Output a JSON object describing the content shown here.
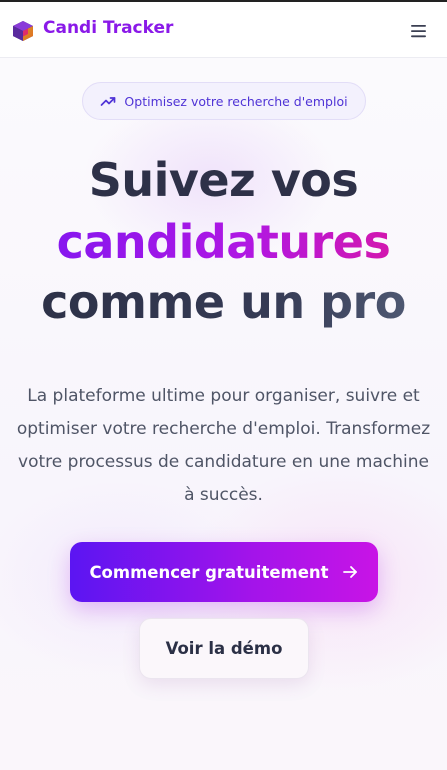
{
  "header": {
    "brand": "Candi Tracker",
    "logo_icon": "candi-logo-icon",
    "menu_icon": "hamburger-menu-icon"
  },
  "hero": {
    "badge": {
      "icon": "trending-up-icon",
      "text": "Optimisez votre recherche d'emploi"
    },
    "title_line1": "Suivez vos",
    "title_line2": "candidatures",
    "title_line3": "comme un pro",
    "description": "La plateforme ultime pour organiser, suivre et optimiser votre recherche d'emploi. Transformez votre processus de candidature en une machine à succès.",
    "primary_cta": {
      "label": "Commencer gratuitement",
      "icon": "arrow-right-icon"
    },
    "secondary_cta": {
      "label": "Voir la démo"
    }
  },
  "colors": {
    "brand": "#8a19e8",
    "gradient_start": "#5b15f2",
    "gradient_end": "#e0179a",
    "badge_text": "#4f33d6",
    "text_dark": "#2b3046"
  }
}
